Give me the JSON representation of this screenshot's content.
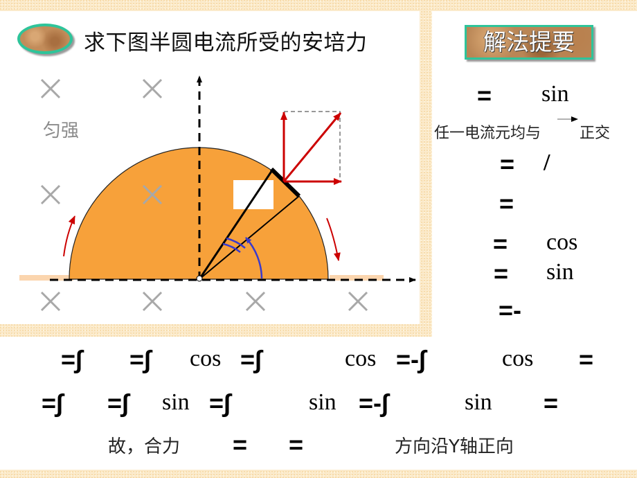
{
  "title": "求下图半圆电流所受的安培力",
  "method_label": "解法提要",
  "diagram": {
    "field_label": "匀强",
    "field_symbol": "×",
    "colors": {
      "semicircle_fill": "#f7a13a",
      "force_arrows": "#cc0000",
      "angle_arcs": "#3a3acc",
      "field_marks": "#a8a8a8",
      "feed_wires": "#fbd5ae"
    }
  },
  "right_panel": {
    "line1": {
      "eq": "=",
      "fn": "sin"
    },
    "note": "任一电流元均与",
    "note_tail": "正交",
    "line2": {
      "eq": "=",
      "op": "/"
    },
    "line3": {
      "eq": "="
    },
    "line4": {
      "eq": "=",
      "fn": "cos"
    },
    "line5": {
      "eq": "=",
      "fn": "sin"
    },
    "line6": {
      "eq": "=-"
    }
  },
  "bottom": {
    "row1": [
      {
        "eq": "=∫"
      },
      {
        "eq": "=∫"
      },
      {
        "fn": "cos"
      },
      {
        "eq": "=∫"
      },
      {
        "fn": "cos"
      },
      {
        "eq": "=-∫"
      },
      {
        "fn": "cos"
      },
      {
        "eq": "="
      }
    ],
    "row2": [
      {
        "eq": "=∫"
      },
      {
        "eq": "=∫"
      },
      {
        "fn": "sin"
      },
      {
        "eq": "=∫"
      },
      {
        "fn": "sin"
      },
      {
        "eq": "=-∫"
      },
      {
        "fn": "sin"
      },
      {
        "eq": "="
      }
    ],
    "conclusion": {
      "prefix": "故，合力",
      "eq1": "=",
      "eq2": "=",
      "direction": "方向沿Y轴正向"
    }
  }
}
